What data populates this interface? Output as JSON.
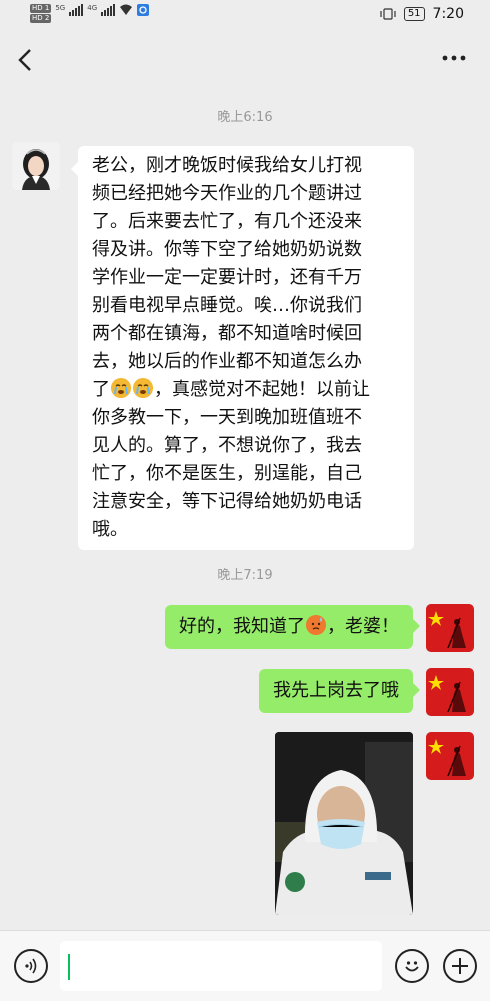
{
  "status_bar": {
    "sim1": "HD 1",
    "sim2": "HD 2",
    "net1": "5G",
    "net2": "4G",
    "battery": "51",
    "time": "7:20"
  },
  "nav": {
    "back_icon": "chevron-left-icon",
    "more_icon": "ellipsis-icon"
  },
  "chat": {
    "timestamps": [
      "晚上6:16",
      "晚上7:19"
    ],
    "incoming": {
      "lines": [
        "老公，刚才晚饭时候我给女儿打视",
        "频已经把她今天作业的几个题讲过",
        "了。后来要去忙了，有几个还没来",
        "得及讲。你等下空了给她奶奶说数",
        "学作业一定一定要计时，还有千万",
        "别看电视早点睡觉。唉…你说我们",
        "两个都在镇海，都不知道啥时候回",
        "去，她以后的作业都不知道怎么办",
        "了",
        "，真感觉对不起她！以前让",
        "你多教一下，一天到晚加班值班不",
        "见人的。算了，不想说你了，我去",
        "忙了，你不是医生，别逞能，自己",
        "注意安全，等下记得给她奶奶电话",
        "哦。"
      ],
      "emojis": [
        "crying-face-emoji",
        "crying-face-emoji"
      ]
    },
    "outgoing1": {
      "before": "好的，我知道了",
      "after": "，老婆！",
      "emoji": "sweating-face-emoji"
    },
    "outgoing2": {
      "text": "我先上岗去了哦"
    },
    "photo": {
      "subject": "person-in-protective-suit-photo"
    }
  },
  "bottom_bar": {
    "voice_icon": "voice-icon",
    "emoji_icon": "emoji-icon",
    "add_icon": "plus-icon"
  },
  "colors": {
    "background": "#ededed",
    "bubble_out": "#95ec69",
    "bubble_in": "#ffffff",
    "accent": "#07c160"
  }
}
